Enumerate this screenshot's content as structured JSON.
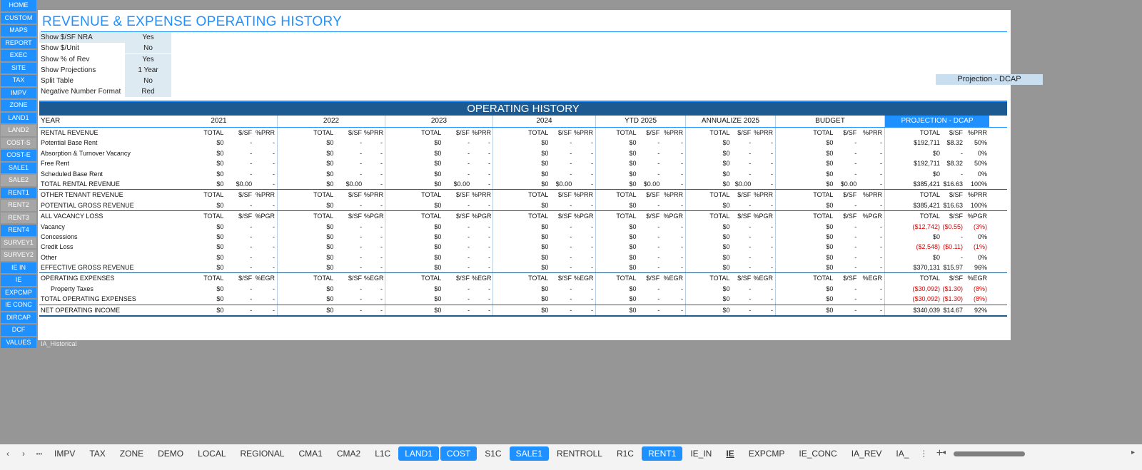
{
  "nav": [
    {
      "label": "HOME",
      "grey": false
    },
    {
      "label": "CUSTOM",
      "grey": false
    },
    {
      "label": "MAPS",
      "grey": false
    },
    {
      "label": "REPORT",
      "grey": false
    },
    {
      "label": "EXEC",
      "grey": false
    },
    {
      "label": "SITE",
      "grey": false
    },
    {
      "label": "TAX",
      "grey": false
    },
    {
      "label": "IMPV",
      "grey": false
    },
    {
      "label": "ZONE",
      "grey": false
    },
    {
      "label": "LAND1",
      "grey": false
    },
    {
      "label": "LAND2",
      "grey": true
    },
    {
      "label": "COST-S",
      "grey": true
    },
    {
      "label": "COST-E",
      "grey": false
    },
    {
      "label": "SALE1",
      "grey": false
    },
    {
      "label": "SALE2",
      "grey": true
    },
    {
      "label": "RENT1",
      "grey": false
    },
    {
      "label": "RENT2",
      "grey": true
    },
    {
      "label": "RENT3",
      "grey": true
    },
    {
      "label": "RENT4",
      "grey": false
    },
    {
      "label": "SURVEY1",
      "grey": true
    },
    {
      "label": "SURVEY2",
      "grey": true
    },
    {
      "label": "IE IN",
      "grey": false
    },
    {
      "label": "IE",
      "grey": false
    },
    {
      "label": "EXPCMP",
      "grey": false
    },
    {
      "label": "IE CONC",
      "grey": false
    },
    {
      "label": "DIRCAP",
      "grey": false
    },
    {
      "label": "DCF",
      "grey": false
    },
    {
      "label": "VALUES",
      "grey": false
    }
  ],
  "title": "REVENUE & EXPENSE OPERATING HISTORY",
  "options": [
    {
      "label": "Show $/SF NRA",
      "value": "Yes"
    },
    {
      "label": "Show $/Unit",
      "value": "No"
    },
    {
      "label": "Show % of Rev",
      "value": "Yes"
    },
    {
      "label": "Show Projections",
      "value": "1 Year"
    },
    {
      "label": "Split Table",
      "value": "No"
    },
    {
      "label": "Negative Number Format",
      "value": "Red"
    }
  ],
  "projection_label": "Projection - DCAP",
  "banner": "OPERATING HISTORY",
  "year_label": "YEAR",
  "groups": [
    "2021",
    "2022",
    "2023",
    "2024",
    "YTD 2025",
    "ANNUALIZE 2025",
    "BUDGET",
    "PROJECTION - DCAP"
  ],
  "rows": [
    {
      "label": "RENTAL REVENUE",
      "type": "sub",
      "cols": [
        "TOTAL",
        "$/SF",
        "%PRR"
      ]
    },
    {
      "label": "Potential Base Rent",
      "type": "data",
      "hist": [
        "$0",
        "-",
        "-"
      ],
      "proj": [
        "$192,711",
        "$8.32",
        "50%"
      ]
    },
    {
      "label": "Absorption & Turnover Vacancy",
      "type": "data",
      "hist": [
        "$0",
        "-",
        "-"
      ],
      "proj": [
        "$0",
        "-",
        "0%"
      ]
    },
    {
      "label": "Free Rent",
      "type": "data",
      "hist": [
        "$0",
        "-",
        "-"
      ],
      "proj": [
        "$192,711",
        "$8.32",
        "50%"
      ]
    },
    {
      "label": "Scheduled Base Rent",
      "type": "data",
      "hist": [
        "$0",
        "-",
        "-"
      ],
      "proj": [
        "$0",
        "-",
        "0%"
      ]
    },
    {
      "label": "TOTAL RENTAL REVENUE",
      "type": "total",
      "hist": [
        "$0",
        "$0.00",
        "-"
      ],
      "proj": [
        "$385,421",
        "$16.63",
        "100%"
      ]
    },
    {
      "label": "OTHER TENANT REVENUE",
      "type": "sub",
      "cols": [
        "TOTAL",
        "$/SF",
        "%PRR"
      ]
    },
    {
      "label": "POTENTIAL GROSS REVENUE",
      "type": "total",
      "hist": [
        "$0",
        "-",
        "-"
      ],
      "proj": [
        "$385,421",
        "$16.63",
        "100%"
      ]
    },
    {
      "label": "ALL VACANCY LOSS",
      "type": "sub",
      "cols": [
        "TOTAL",
        "$/SF",
        "%PGR"
      ]
    },
    {
      "label": "Vacancy",
      "type": "data",
      "hist": [
        "$0",
        "-",
        "-"
      ],
      "proj": [
        "($12,742)",
        "($0.55)",
        "(3%)"
      ],
      "neg": true
    },
    {
      "label": "Concessions",
      "type": "data",
      "hist": [
        "$0",
        "-",
        "-"
      ],
      "proj": [
        "$0",
        "-",
        "0%"
      ]
    },
    {
      "label": "Credit Loss",
      "type": "data",
      "hist": [
        "$0",
        "-",
        "-"
      ],
      "proj": [
        "($2,548)",
        "($0.11)",
        "(1%)"
      ],
      "neg": true
    },
    {
      "label": "Other",
      "type": "data",
      "hist": [
        "$0",
        "-",
        "-"
      ],
      "proj": [
        "$0",
        "-",
        "0%"
      ]
    },
    {
      "label": "EFFECTIVE GROSS REVENUE",
      "type": "total",
      "hist": [
        "$0",
        "-",
        "-"
      ],
      "proj": [
        "$370,131",
        "$15.97",
        "96%"
      ]
    },
    {
      "label": "OPERATING EXPENSES",
      "type": "sub",
      "cols": [
        "TOTAL",
        "$/SF",
        "%EGR"
      ]
    },
    {
      "label": "Property Taxes",
      "type": "data",
      "indent": true,
      "hist": [
        "$0",
        "-",
        "-"
      ],
      "proj": [
        "($30,092)",
        "($1.30)",
        "(8%)"
      ],
      "neg": true
    },
    {
      "label": "TOTAL OPERATING EXPENSES",
      "type": "total",
      "hist": [
        "$0",
        "-",
        "-"
      ],
      "proj": [
        "($30,092)",
        "($1.30)",
        "(8%)"
      ],
      "neg": true
    },
    {
      "label": "NET OPERATING INCOME",
      "type": "total",
      "hist": [
        "$0",
        "-",
        "-"
      ],
      "proj": [
        "$340,039",
        "$14.67",
        "92%"
      ],
      "last": true
    }
  ],
  "sheet_name": "IA_Historical",
  "tabs": [
    {
      "label": "IMPV"
    },
    {
      "label": "TAX"
    },
    {
      "label": "ZONE"
    },
    {
      "label": "DEMO"
    },
    {
      "label": "LOCAL"
    },
    {
      "label": "REGIONAL"
    },
    {
      "label": "CMA1"
    },
    {
      "label": "CMA2"
    },
    {
      "label": "L1C"
    },
    {
      "label": "LAND1",
      "blue": true
    },
    {
      "label": "COST",
      "blue": true
    },
    {
      "label": "S1C"
    },
    {
      "label": "SALE1",
      "blue": true
    },
    {
      "label": "RENTROLL"
    },
    {
      "label": "R1C"
    },
    {
      "label": "RENT1",
      "blue": true
    },
    {
      "label": "IE_IN"
    },
    {
      "label": "IE",
      "active": true
    },
    {
      "label": "EXPCMP"
    },
    {
      "label": "IE_CONC"
    },
    {
      "label": "IA_REV"
    },
    {
      "label": "IA_"
    }
  ],
  "tab_controls": {
    "prev": "‹",
    "next": "›",
    "more": "•••",
    "more2": "⋮",
    "add": "+",
    "scroll_left": "◂",
    "scroll_right": "▸"
  }
}
